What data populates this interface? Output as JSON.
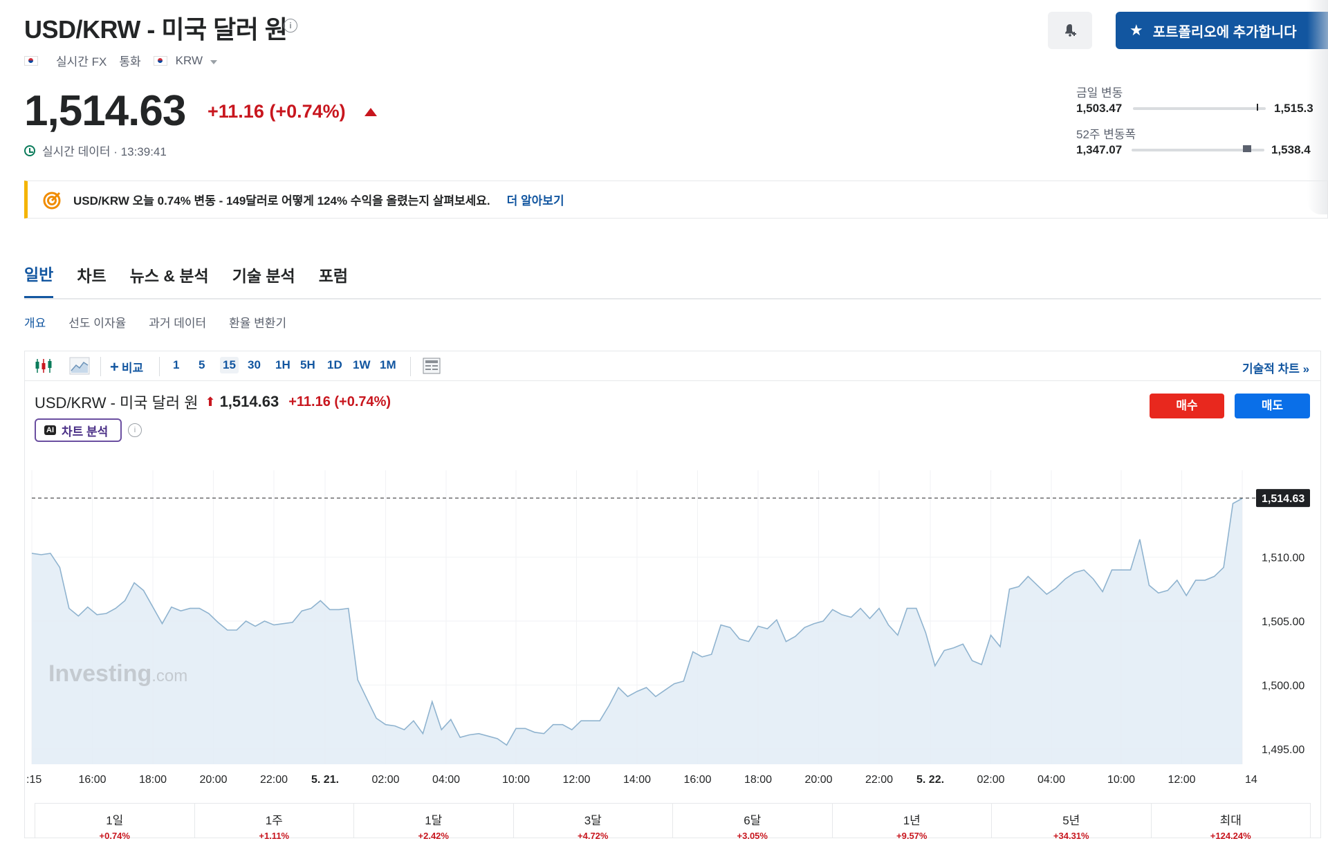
{
  "header": {
    "title": "USD/KRW - 미국 달러 원",
    "meta_realtime": "실시간 FX",
    "meta_currency_label": "통화",
    "meta_currency": "KRW",
    "price": "1,514.63",
    "change": "+11.16 (+0.74%)",
    "realtime_text": "실시간 데이터 · 13:39:41",
    "portfolio_button": "포트폴리오에 추가합니다"
  },
  "ranges": {
    "day_label": "금일 변동",
    "day_low": "1,503.47",
    "day_high": "1,515.3",
    "day_position": 0.93,
    "week52_label": "52주 변동폭",
    "week52_low": "1,347.07",
    "week52_high": "1,538.4",
    "week52_position": 0.87
  },
  "banner": {
    "text": "USD/KRW 오늘 0.74% 변동 - 149달러로 어떻게 124% 수익을 올렸는지 살펴보세요.",
    "link": "더 알아보기"
  },
  "tabs": [
    "일반",
    "차트",
    "뉴스 & 분석",
    "기술 분석",
    "포럼"
  ],
  "subtabs": [
    "개요",
    "선도 이자율",
    "과거 데이터",
    "환율 변환기"
  ],
  "toolbar": {
    "compare": "비교",
    "timeframes": [
      "1",
      "5",
      "15",
      "30",
      "1H",
      "5H",
      "1D",
      "1W",
      "1M"
    ],
    "active_timeframe": "15",
    "technical_chart": "기술적 차트 »"
  },
  "chart_header": {
    "name": "USD/KRW - 미국 달러 원",
    "price": "1,514.63",
    "change": "+11.16 (+0.74%)",
    "ai_button": "차트 분석",
    "ai_badge": "AI",
    "buy": "매수",
    "sell": "매도"
  },
  "watermark": {
    "brand": "Investing",
    "suffix": ".com"
  },
  "colors": {
    "accent": "#1256a0",
    "negative_red": "#c8161e",
    "line": "#8fb3cf",
    "area": "#e3edf6",
    "buy": "#e8281e",
    "sell": "#0a6fe8"
  },
  "chart_data": {
    "type": "area",
    "title": "",
    "xlabel": "",
    "ylabel": "",
    "ylim": [
      1493.8,
      1516.8
    ],
    "y_ticks": [
      1510.0,
      1505.0,
      1500.0,
      1495.0
    ],
    "y_tick_labels": [
      "1,510.00",
      "1,505.00",
      "1,500.00",
      "1,495.00"
    ],
    "last_price": 1514.63,
    "last_price_label": "1,514.63",
    "x_tick_labels": [
      ":15",
      "16:00",
      "18:00",
      "20:00",
      "22:00",
      "5. 21.",
      "02:00",
      "04:00",
      "10:00",
      "12:00",
      "14:00",
      "16:00",
      "18:00",
      "20:00",
      "22:00",
      "5. 22.",
      "02:00",
      "04:00",
      "10:00",
      "12:00",
      "14"
    ],
    "x_tick_index": [
      0,
      6.5,
      13,
      19.5,
      26,
      31.5,
      38,
      44.5,
      52,
      58.5,
      65,
      71.5,
      78,
      84.5,
      91,
      96.5,
      103,
      109.5,
      117,
      123.5,
      130
    ],
    "x_count": 130,
    "values": [
      1510.3,
      1510.2,
      1510.3,
      1509.2,
      1506.0,
      1505.4,
      1506.1,
      1505.5,
      1505.6,
      1506.0,
      1506.6,
      1508.0,
      1507.4,
      1506.1,
      1504.8,
      1506.1,
      1505.8,
      1506.0,
      1506.0,
      1505.6,
      1504.9,
      1504.3,
      1504.3,
      1505.0,
      1504.6,
      1505.0,
      1504.7,
      1504.8,
      1504.9,
      1505.8,
      1506.0,
      1506.6,
      1505.9,
      1505.9,
      1506.0,
      1500.4,
      1498.9,
      1497.4,
      1496.9,
      1496.8,
      1496.5,
      1497.2,
      1496.2,
      1498.7,
      1496.5,
      1497.3,
      1495.9,
      1496.1,
      1496.2,
      1496.0,
      1495.8,
      1495.3,
      1496.6,
      1496.6,
      1496.3,
      1496.2,
      1496.9,
      1496.9,
      1496.5,
      1497.2,
      1497.2,
      1497.2,
      1498.4,
      1499.8,
      1499.1,
      1499.5,
      1499.8,
      1499.1,
      1499.6,
      1500.1,
      1500.3,
      1502.6,
      1502.2,
      1502.4,
      1504.7,
      1504.5,
      1503.6,
      1503.4,
      1504.6,
      1504.4,
      1505.1,
      1503.4,
      1503.8,
      1504.5,
      1504.8,
      1505.0,
      1505.9,
      1505.5,
      1505.3,
      1506.0,
      1505.2,
      1506.0,
      1504.7,
      1503.9,
      1506.0,
      1506.0,
      1504.1,
      1501.5,
      1502.7,
      1502.9,
      1503.2,
      1501.9,
      1501.6,
      1503.9,
      1503.0,
      1507.5,
      1507.7,
      1508.5,
      1507.8,
      1507.1,
      1507.6,
      1508.3,
      1508.8,
      1509.0,
      1508.3,
      1507.3,
      1509.0,
      1509.0,
      1509.0,
      1511.4,
      1507.8,
      1507.2,
      1507.4,
      1508.2,
      1507.0,
      1508.2,
      1508.2,
      1508.5,
      1509.2,
      1514.2,
      1514.6
    ]
  },
  "performance": [
    {
      "label": "1일",
      "value": "+0.74%"
    },
    {
      "label": "1주",
      "value": "+1.11%"
    },
    {
      "label": "1달",
      "value": "+2.42%"
    },
    {
      "label": "3달",
      "value": "+4.72%"
    },
    {
      "label": "6달",
      "value": "+3.05%"
    },
    {
      "label": "1년",
      "value": "+9.57%"
    },
    {
      "label": "5년",
      "value": "+34.31%"
    },
    {
      "label": "최대",
      "value": "+124.24%"
    }
  ]
}
